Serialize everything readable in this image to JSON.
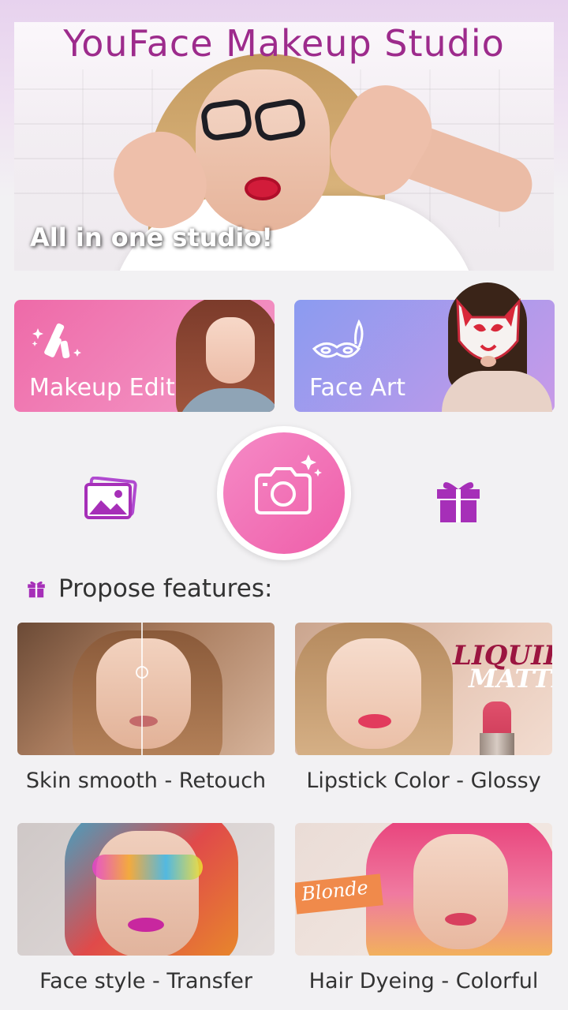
{
  "app": {
    "title": "YouFace Makeup Studio"
  },
  "hero": {
    "tagline": "All in one studio!"
  },
  "cards": {
    "makeup": {
      "label": "Makeup Edit",
      "icon": "makeup-tools-icon"
    },
    "face_art": {
      "label": "Face Art",
      "icon": "mask-icon"
    }
  },
  "actions": {
    "gallery_icon": "gallery-icon",
    "camera_icon": "camera-icon",
    "gift_icon": "gift-icon"
  },
  "propose": {
    "title": "Propose features:",
    "icon": "gift-icon",
    "items": [
      {
        "caption": "Skin smooth - Retouch"
      },
      {
        "caption": "Lipstick Color - Glossy",
        "image_text": [
          "LIQUID",
          "MATTE"
        ]
      },
      {
        "caption": "Face style - Transfer"
      },
      {
        "caption": "Hair Dyeing - Colorful",
        "image_text": [
          "Blonde"
        ]
      }
    ]
  },
  "colors": {
    "brand_purple": "#9d2b8c",
    "makeup_card": "#ee6aa8",
    "face_card": "#8b9bf0",
    "camera": "#ef5ea9",
    "icon_purple": "#a62fb8"
  }
}
